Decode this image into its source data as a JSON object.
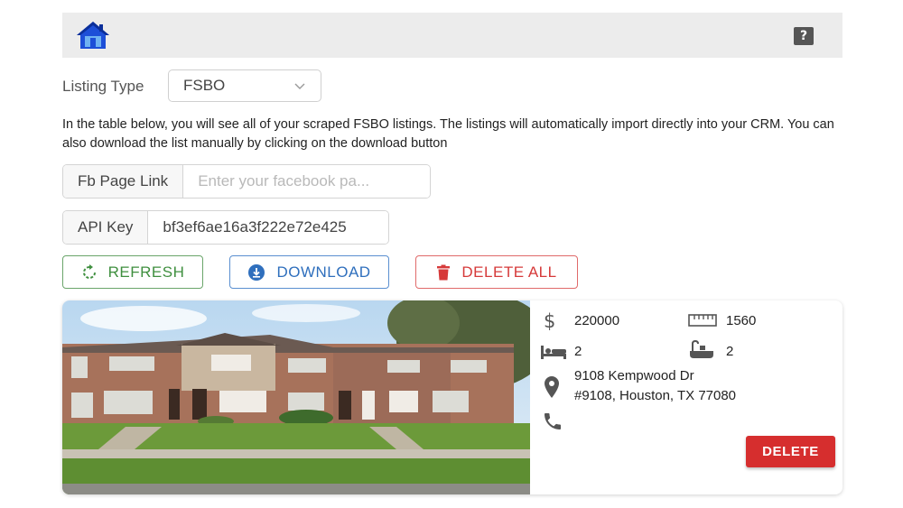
{
  "header": {
    "logo_icon": "house-icon",
    "help_label": "?"
  },
  "listing_type": {
    "label": "Listing Type",
    "selected": "FSBO"
  },
  "description": "In the table below, you will see all of your scraped FSBO listings. The listings will automatically import directly into your CRM. You can also download the list manually by clicking on the download button",
  "fb_page": {
    "label": "Fb Page Link",
    "placeholder": "Enter your facebook pa...",
    "value": ""
  },
  "api_key": {
    "label": "API Key",
    "value": "bf3ef6ae16a3f222e72e425"
  },
  "actions": {
    "refresh_label": "REFRESH",
    "download_label": "DOWNLOAD",
    "delete_all_label": "DELETE ALL"
  },
  "listing": {
    "price": "220000",
    "sqft": "1560",
    "beds": "2",
    "baths": "2",
    "address_line1": "9108 Kempwood Dr",
    "address_line2": "#9108, Houston, TX 77080",
    "phone": "",
    "delete_label": "DELETE"
  },
  "colors": {
    "refresh": "#3f8f3f",
    "download": "#2f6fbd",
    "delete": "#d62e2e",
    "topbar": "#ececec"
  }
}
